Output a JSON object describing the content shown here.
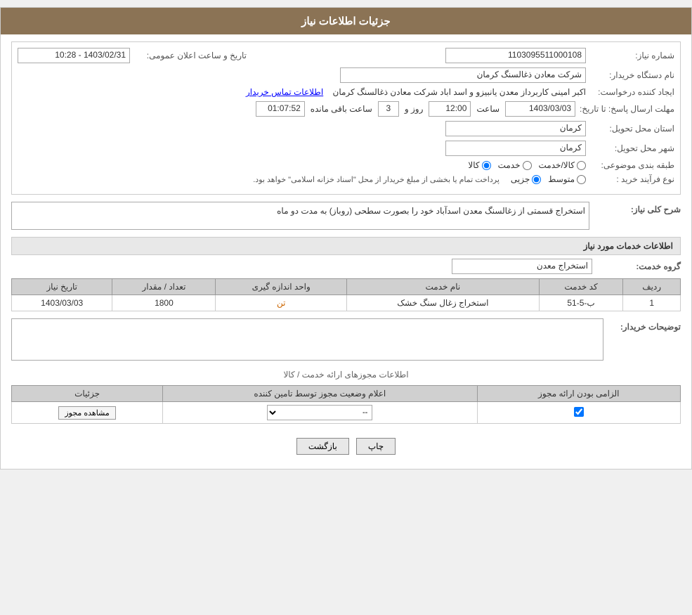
{
  "header": {
    "title": "جزئیات اطلاعات نیاز"
  },
  "fields": {
    "need_number_label": "شماره نیاز:",
    "need_number_value": "1103095511000108",
    "buyer_org_label": "نام دستگاه خریدار:",
    "buyer_org_value": "شرکت معادن ذغالسنگ کرمان",
    "creator_label": "ایجاد کننده درخواست:",
    "creator_value": "اکبر امینی کاربرداز معدن یانبیزو و اسد اباد شرکت معادن ذغالسنگ کرمان",
    "contact_link": "اطلاعات تماس خریدار",
    "deadline_label": "مهلت ارسال پاسخ: تا تاریخ:",
    "deadline_date": "1403/03/03",
    "deadline_time_label": "ساعت",
    "deadline_time": "12:00",
    "deadline_days_label": "روز و",
    "deadline_days": "3",
    "deadline_remaining_label": "ساعت باقی مانده",
    "deadline_remaining": "01:07:52",
    "announce_label": "تاریخ و ساعت اعلان عمومی:",
    "announce_value": "1403/02/31 - 10:28",
    "province_label": "استان محل تحویل:",
    "province_value": "کرمان",
    "city_label": "شهر محل تحویل:",
    "city_value": "کرمان",
    "category_label": "طبقه بندی موضوعی:",
    "category_kala": "کالا",
    "category_khedmat": "خدمت",
    "category_kala_khedmat": "کالا/خدمت",
    "purchase_type_label": "نوع فرآیند خرید :",
    "purchase_jozii": "جزیی",
    "purchase_motovaset": "متوسط",
    "purchase_note": "پرداخت تمام یا بخشی از مبلغ خریدار از محل \"اسناد خزانه اسلامی\" خواهد بود.",
    "general_desc_label": "شرح کلی نیاز:",
    "general_desc_value": "استخراج قسمتی از زغالسنگ معدن اسدآباد خود را بصورت سطحی (روباز)  به مدت دو ماه",
    "services_title": "اطلاعات خدمات مورد نیاز",
    "service_group_label": "گروه خدمت:",
    "service_group_value": "استخراج معدن"
  },
  "table": {
    "headers": [
      "ردیف",
      "کد خدمت",
      "نام خدمت",
      "واحد اندازه گیری",
      "تعداد / مقدار",
      "تاریخ نیاز"
    ],
    "rows": [
      {
        "row": "1",
        "code": "ب-5-51",
        "name": "استخراج زغال سنگ خشک",
        "unit": "تن",
        "qty": "1800",
        "date": "1403/03/03"
      }
    ]
  },
  "buyer_notes_label": "توضیحات خریدار:",
  "permits_section": {
    "divider_text": "اطلاعات مجوزهای ارائه خدمت / کالا",
    "headers": [
      "الزامی بودن ارائه مجوز",
      "اعلام وضعیت مجوز توسط تامین کننده",
      "جزئیات"
    ],
    "rows": [
      {
        "required": true,
        "status": "--",
        "details_btn": "مشاهده مجوز"
      }
    ]
  },
  "buttons": {
    "print": "چاپ",
    "back": "بازگشت"
  }
}
